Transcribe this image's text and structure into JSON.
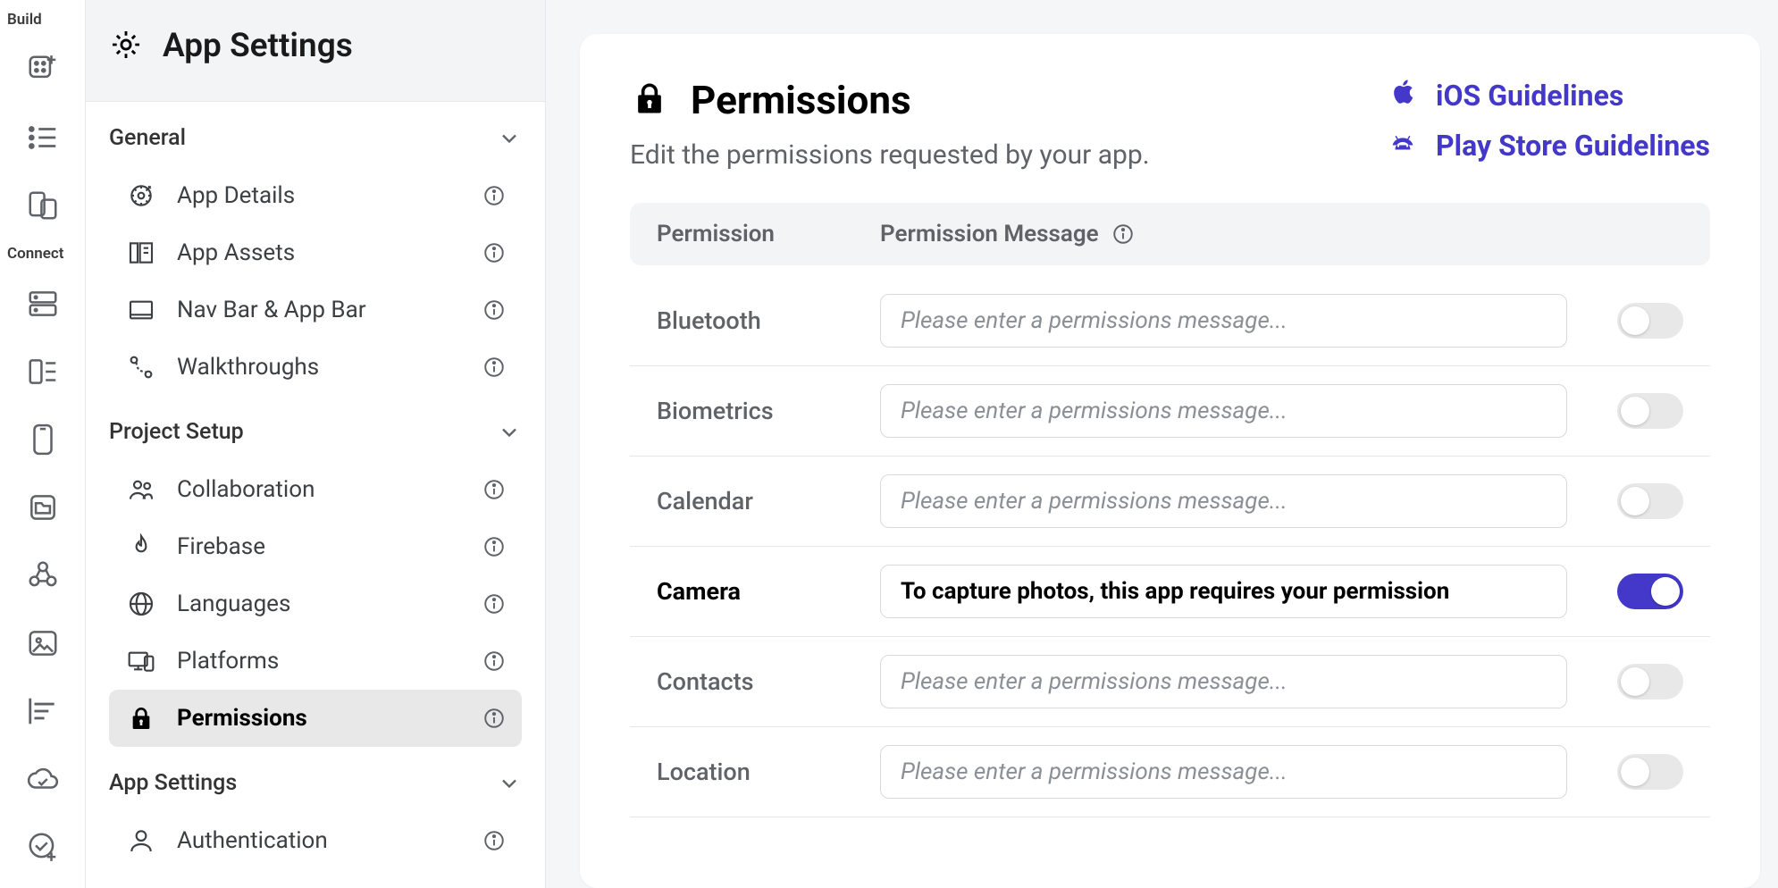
{
  "rail": {
    "build_label": "Build",
    "connect_label": "Connect"
  },
  "sidebar": {
    "title": "App Settings",
    "sections": {
      "general": {
        "title": "General",
        "items": [
          {
            "label": "App Details"
          },
          {
            "label": "App Assets"
          },
          {
            "label": "Nav Bar & App Bar"
          },
          {
            "label": "Walkthroughs"
          }
        ]
      },
      "project_setup": {
        "title": "Project Setup",
        "items": [
          {
            "label": "Collaboration"
          },
          {
            "label": "Firebase"
          },
          {
            "label": "Languages"
          },
          {
            "label": "Platforms"
          },
          {
            "label": "Permissions"
          }
        ]
      },
      "app_settings": {
        "title": "App Settings",
        "items": [
          {
            "label": "Authentication"
          }
        ]
      }
    }
  },
  "main": {
    "title": "Permissions",
    "subtitle": "Edit the permissions requested by your app.",
    "guidelines": {
      "ios": "iOS Guidelines",
      "play": "Play Store Guidelines"
    },
    "columns": {
      "permission": "Permission",
      "message": "Permission Message"
    },
    "placeholder": "Please enter a permissions message...",
    "rows": [
      {
        "name": "Bluetooth",
        "value": "",
        "on": false
      },
      {
        "name": "Biometrics",
        "value": "",
        "on": false
      },
      {
        "name": "Calendar",
        "value": "",
        "on": false
      },
      {
        "name": "Camera",
        "value": "To capture photos, this app requires your permission",
        "on": true
      },
      {
        "name": "Contacts",
        "value": "",
        "on": false
      },
      {
        "name": "Location",
        "value": "",
        "on": false
      }
    ]
  }
}
